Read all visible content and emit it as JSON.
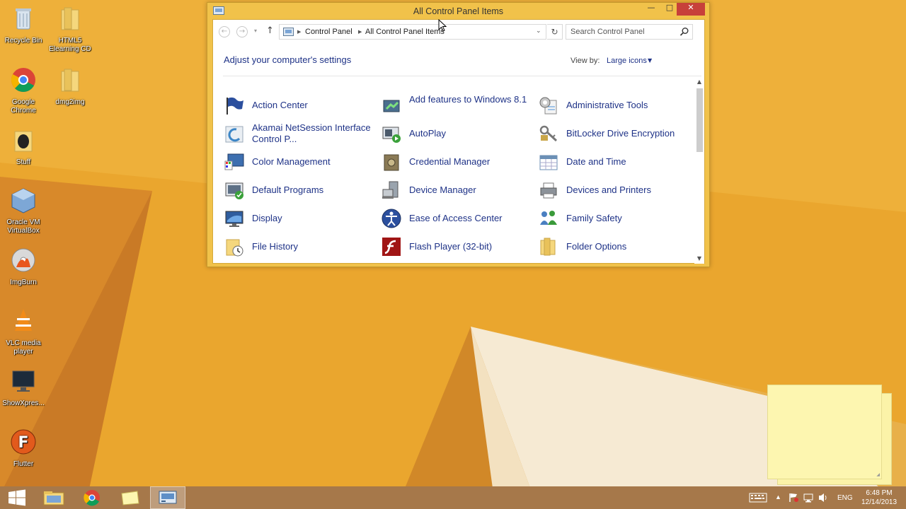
{
  "desktop": {
    "icons": [
      {
        "label": "Recycle Bin",
        "icon": "recycle-bin-icon"
      },
      {
        "label": "HTML5 Elearning CD",
        "icon": "folder-icon"
      },
      {
        "label": "Google Chrome",
        "icon": "chrome-icon"
      },
      {
        "label": "dmg2img",
        "icon": "folder-icon"
      },
      {
        "label": "Stuff",
        "icon": "folder-icon"
      },
      {
        "label": "Oracle VM VirtualBox",
        "icon": "virtualbox-icon"
      },
      {
        "label": "ImgBurn",
        "icon": "imgburn-icon"
      },
      {
        "label": "VLC media player",
        "icon": "vlc-icon"
      },
      {
        "label": "ShowXpres...",
        "icon": "monitor-icon"
      },
      {
        "label": "Flutter",
        "icon": "flutter-icon"
      }
    ]
  },
  "window": {
    "title": "All Control Panel Items",
    "caption": {
      "minimize": "—",
      "maximize": "□",
      "close": "✕"
    }
  },
  "address": {
    "breadcrumbs": [
      "Control Panel",
      "All Control Panel Items"
    ]
  },
  "search": {
    "placeholder": "Search Control Panel"
  },
  "content": {
    "heading": "Adjust your computer's settings",
    "view_by_label": "View by:",
    "view_by_value": "Large icons"
  },
  "items": [
    {
      "label": "Action Center",
      "icon": "flag-icon"
    },
    {
      "label": "Add features to Windows 8.1",
      "icon": "add-features-icon"
    },
    {
      "label": "Administrative Tools",
      "icon": "admin-tools-icon"
    },
    {
      "label": "Akamai NetSession Interface Control P...",
      "icon": "akamai-icon"
    },
    {
      "label": "AutoPlay",
      "icon": "autoplay-icon"
    },
    {
      "label": "BitLocker Drive Encryption",
      "icon": "bitlocker-keys-icon"
    },
    {
      "label": "Color Management",
      "icon": "color-management-icon"
    },
    {
      "label": "Credential Manager",
      "icon": "credential-vault-icon"
    },
    {
      "label": "Date and Time",
      "icon": "calendar-clock-icon"
    },
    {
      "label": "Default Programs",
      "icon": "default-programs-icon"
    },
    {
      "label": "Device Manager",
      "icon": "device-manager-icon"
    },
    {
      "label": "Devices and Printers",
      "icon": "printer-icon"
    },
    {
      "label": "Display",
      "icon": "display-monitor-icon"
    },
    {
      "label": "Ease of Access Center",
      "icon": "ease-of-access-icon"
    },
    {
      "label": "Family Safety",
      "icon": "family-safety-icon"
    },
    {
      "label": "File History",
      "icon": "file-history-icon"
    },
    {
      "label": "Flash Player (32-bit)",
      "icon": "flash-player-icon"
    },
    {
      "label": "Folder Options",
      "icon": "folder-options-icon"
    }
  ],
  "taskbar": {
    "language": "ENG",
    "time": "6:48 PM",
    "date": "12/14/2013"
  },
  "colors": {
    "link": "#1e3287",
    "window_frame": "#f1c24a",
    "close_button": "#c7403a",
    "taskbar": "#a6784a",
    "wallpaper": "#e9a32b"
  }
}
